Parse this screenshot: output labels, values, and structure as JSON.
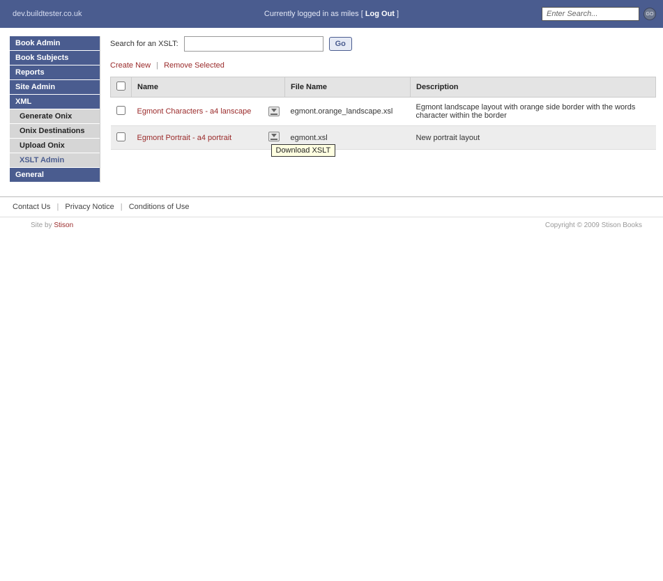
{
  "header": {
    "domain": "dev.buildtester.co.uk",
    "logged_in_prefix": "Currently logged in as miles [ ",
    "logout": "Log Out",
    "logged_in_suffix": " ]",
    "search_placeholder": "Enter Search...",
    "go_label": "GO"
  },
  "sidebar": {
    "items": [
      {
        "label": "Book Admin",
        "type": "section"
      },
      {
        "label": "Book Subjects",
        "type": "section"
      },
      {
        "label": "Reports",
        "type": "section"
      },
      {
        "label": "Site Admin",
        "type": "section"
      },
      {
        "label": "XML",
        "type": "section"
      },
      {
        "label": "Generate Onix",
        "type": "sub"
      },
      {
        "label": "Onix Destinations",
        "type": "sub"
      },
      {
        "label": "Upload Onix",
        "type": "sub"
      },
      {
        "label": "XSLT Admin",
        "type": "sub",
        "active": true
      },
      {
        "label": "General",
        "type": "section"
      }
    ]
  },
  "search": {
    "label": "Search for an XSLT:",
    "go": "Go"
  },
  "actions": {
    "create": "Create New",
    "remove": "Remove Selected"
  },
  "table": {
    "headers": {
      "name": "Name",
      "file": "File Name",
      "desc": "Description"
    },
    "rows": [
      {
        "name": "Egmont Characters - a4 lanscape",
        "file": "egmont.orange_landscape.xsl",
        "desc": "Egmont landscape layout with orange side border with the words character within the border"
      },
      {
        "name": "Egmont Portrait - a4 portrait",
        "file": "egmont.xsl",
        "desc": "New portrait layout"
      }
    ]
  },
  "tooltip": "Download XSLT",
  "footer": {
    "contact": "Contact Us",
    "privacy": "Privacy Notice",
    "conditions": "Conditions of Use",
    "siteby_prefix": "Site by ",
    "siteby_link": "Stison",
    "copyright": "Copyright © 2009 Stison Books"
  }
}
